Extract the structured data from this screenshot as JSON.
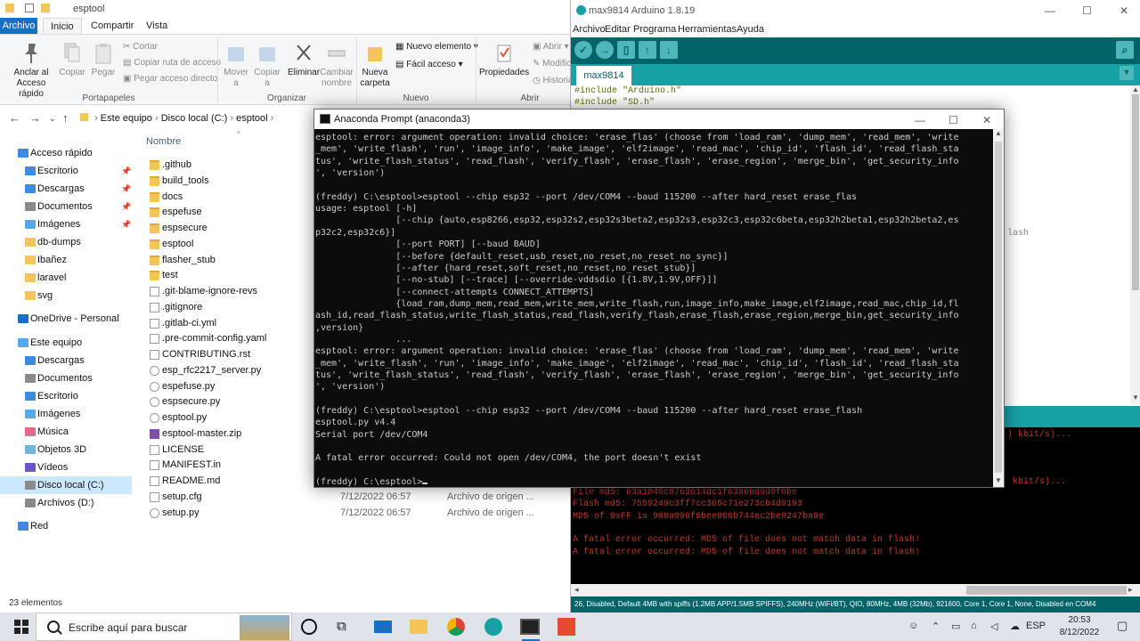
{
  "explorer": {
    "window_title": "esptool",
    "tabs": [
      "Archivo",
      "Inicio",
      "Compartir",
      "Vista"
    ],
    "ribbon": {
      "pin": "Anclar al Acceso rápido",
      "copy": "Copiar",
      "paste": "Pegar",
      "cut": "Cortar",
      "copy_path": "Copiar ruta de acceso",
      "paste_shortcut": "Pegar acceso directo",
      "group_clipboard": "Portapapeles",
      "move": "Mover a",
      "copy_to": "Copiar a",
      "delete": "Eliminar",
      "rename": "Cambiar nombre",
      "group_organize": "Organizar",
      "new_folder": "Nueva carpeta",
      "new_item": "Nuevo elemento",
      "easy_access": "Fácil acceso",
      "group_new": "Nuevo",
      "properties": "Propiedades",
      "open": "Abrir",
      "modify": "Modific",
      "history": "Historia",
      "group_open": "Abrir"
    },
    "breadcrumb": [
      "Este equipo",
      "Disco local (C:)",
      "esptool"
    ],
    "nav": [
      {
        "label": "Acceso rápido",
        "pinned": false
      },
      {
        "label": "Escritorio",
        "pinned": true
      },
      {
        "label": "Descargas",
        "pinned": true
      },
      {
        "label": "Documentos",
        "pinned": true
      },
      {
        "label": "Imágenes",
        "pinned": true
      },
      {
        "label": "db-dumps",
        "pinned": false
      },
      {
        "label": "Ibañez",
        "pinned": false
      },
      {
        "label": "laravel",
        "pinned": false
      },
      {
        "label": "svg",
        "pinned": false
      },
      {
        "label": "OneDrive - Personal",
        "pinned": false
      },
      {
        "label": "Este equipo",
        "pinned": false
      },
      {
        "label": "Descargas",
        "pinned": false
      },
      {
        "label": "Documentos",
        "pinned": false
      },
      {
        "label": "Escritorio",
        "pinned": false
      },
      {
        "label": "Imágenes",
        "pinned": false
      },
      {
        "label": "Música",
        "pinned": false
      },
      {
        "label": "Objetos 3D",
        "pinned": false
      },
      {
        "label": "Vídeos",
        "pinned": false
      },
      {
        "label": "Disco local (C:)",
        "pinned": false
      },
      {
        "label": "Archivos (D:)",
        "pinned": false
      },
      {
        "label": "Red",
        "pinned": false
      }
    ],
    "column_name": "Nombre",
    "files": [
      {
        "name": ".github",
        "kind": "folder",
        "date": "",
        "type": ""
      },
      {
        "name": "build_tools",
        "kind": "folder",
        "date": "",
        "type": ""
      },
      {
        "name": "docs",
        "kind": "folder",
        "date": "",
        "type": ""
      },
      {
        "name": "espefuse",
        "kind": "folder",
        "date": "",
        "type": ""
      },
      {
        "name": "espsecure",
        "kind": "folder",
        "date": "",
        "type": ""
      },
      {
        "name": "esptool",
        "kind": "folder",
        "date": "",
        "type": ""
      },
      {
        "name": "flasher_stub",
        "kind": "folder",
        "date": "",
        "type": ""
      },
      {
        "name": "test",
        "kind": "folder",
        "date": "",
        "type": ""
      },
      {
        "name": ".git-blame-ignore-revs",
        "kind": "doc",
        "date": "",
        "type": ""
      },
      {
        "name": ".gitignore",
        "kind": "doc",
        "date": "",
        "type": ""
      },
      {
        "name": ".gitlab-ci.yml",
        "kind": "doc",
        "date": "",
        "type": ""
      },
      {
        "name": ".pre-commit-config.yaml",
        "kind": "doc",
        "date": "",
        "type": ""
      },
      {
        "name": "CONTRIBUTING.rst",
        "kind": "doc",
        "date": "",
        "type": ""
      },
      {
        "name": "esp_rfc2217_server.py",
        "kind": "py",
        "date": "",
        "type": ""
      },
      {
        "name": "espefuse.py",
        "kind": "py",
        "date": "",
        "type": ""
      },
      {
        "name": "espsecure.py",
        "kind": "py",
        "date": "",
        "type": ""
      },
      {
        "name": "esptool.py",
        "kind": "py",
        "date": "",
        "type": ""
      },
      {
        "name": "esptool-master.zip",
        "kind": "zip",
        "date": "",
        "type": ""
      },
      {
        "name": "LICENSE",
        "kind": "doc",
        "date": "",
        "type": ""
      },
      {
        "name": "MANIFEST.in",
        "kind": "doc",
        "date": "",
        "type": ""
      },
      {
        "name": "README.md",
        "kind": "doc",
        "date": "",
        "type": ""
      },
      {
        "name": "setup.cfg",
        "kind": "doc",
        "date": "7/12/2022 06:57",
        "type": "Archivo de origen ..."
      },
      {
        "name": "setup.py",
        "kind": "py",
        "date": "7/12/2022 06:57",
        "type": "Archivo de origen ..."
      }
    ],
    "status": "23 elementos"
  },
  "arduino": {
    "title": "max9814 Arduino 1.8.19",
    "menu": [
      "Archivo",
      "Editar",
      "Programa",
      "Herramientas",
      "Ayuda"
    ],
    "tab": "max9814",
    "code": [
      "#include \"Arduino.h\"",
      "#include \"SD.h\""
    ],
    "partial_text": "lash",
    "console_partial_1": ") kbit/s)...",
    "console_partial_2": "kbit/s)...",
    "console": [
      "File  md5: b3a1040c8763614dc1f6386bd9d0f0be",
      "Flash md5: 7559249c3ff7cc365c71e273cb4d0193",
      "MD5 of 0xFF is 988a096f6bee866b744ec2be0247ba9e",
      "",
      "A fatal error occurred: MD5 of file does not match data in flash!",
      "A fatal error occurred: MD5 of file does not match data in flash!"
    ],
    "status": "Disabled, Default 4MB with spiffs (1.2MB APP/1.5MB SPIFFS), 240MHz (WiFi/BT), QIO, 80MHz, 4MB (32Mb), 921600, Core 1, Core 1, None, Disabled en COM4",
    "status_num": "26",
    "colors": {
      "teal": "#006468",
      "teal_light": "#17a1a5"
    }
  },
  "anaconda": {
    "title": "Anaconda Prompt (anaconda3)",
    "lines": [
      "esptool: error: argument operation: invalid choice: 'erase_flas' (choose from 'load_ram', 'dump_mem', 'read_mem', 'write",
      "_mem', 'write_flash', 'run', 'image_info', 'make_image', 'elf2image', 'read_mac', 'chip_id', 'flash_id', 'read_flash_sta",
      "tus', 'write_flash_status', 'read_flash', 'verify_flash', 'erase_flash', 'erase_region', 'merge_bin', 'get_security_info",
      "', 'version')",
      "",
      "(freddy) C:\\esptool>esptool --chip esp32 --port /dev/COM4 --baud 115200 --after hard_reset erase_flas",
      "usage: esptool [-h]",
      "               [--chip {auto,esp8266,esp32,esp32s2,esp32s3beta2,esp32s3,esp32c3,esp32c6beta,esp32h2beta1,esp32h2beta2,es",
      "p32c2,esp32c6}]",
      "               [--port PORT] [--baud BAUD]",
      "               [--before {default_reset,usb_reset,no_reset,no_reset_no_sync}]",
      "               [--after {hard_reset,soft_reset,no_reset,no_reset_stub}]",
      "               [--no-stub] [--trace] [--override-vddsdio [{1.8V,1.9V,OFF}]]",
      "               [--connect-attempts CONNECT_ATTEMPTS]",
      "               {load_ram,dump_mem,read_mem,write_mem,write_flash,run,image_info,make_image,elf2image,read_mac,chip_id,fl",
      "ash_id,read_flash_status,write_flash_status,read_flash,verify_flash,erase_flash,erase_region,merge_bin,get_security_info",
      ",version}",
      "               ...",
      "esptool: error: argument operation: invalid choice: 'erase_flas' (choose from 'load_ram', 'dump_mem', 'read_mem', 'write",
      "_mem', 'write_flash', 'run', 'image_info', 'make_image', 'elf2image', 'read_mac', 'chip_id', 'flash_id', 'read_flash_sta",
      "tus', 'write_flash_status', 'read_flash', 'verify_flash', 'erase_flash', 'erase_region', 'merge_bin', 'get_security_info",
      "', 'version')",
      "",
      "(freddy) C:\\esptool>esptool --chip esp32 --port /dev/COM4 --baud 115200 --after hard_reset erase_flash",
      "esptool.py v4.4",
      "Serial port /dev/COM4",
      "",
      "A fatal error occurred: Could not open /dev/COM4, the port doesn't exist",
      "",
      "(freddy) C:\\esptool>"
    ]
  },
  "taskbar": {
    "search_placeholder": "Escribe aquí para buscar",
    "lang": "ESP",
    "time": "20:53",
    "date": "8/12/2022"
  }
}
